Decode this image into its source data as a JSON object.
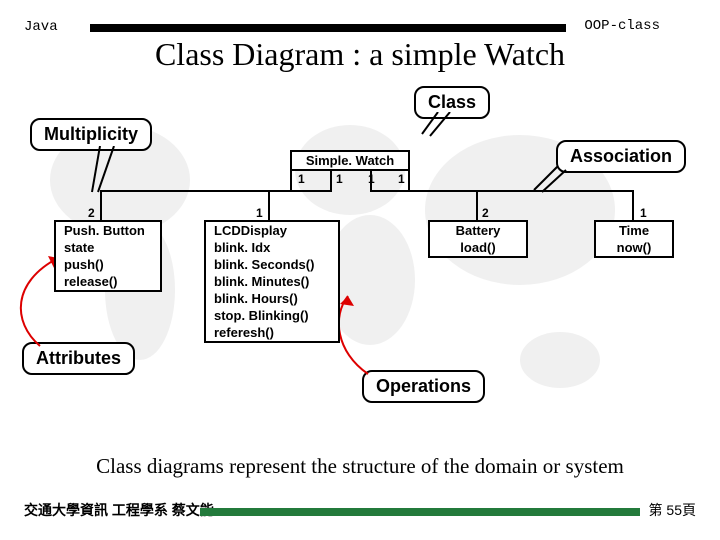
{
  "header": {
    "left": "Java",
    "right": "OOP-class"
  },
  "title": "Class Diagram : a simple Watch",
  "callouts": {
    "class": "Class",
    "multiplicity": "Multiplicity",
    "association": "Association",
    "attributes": "Attributes",
    "operations": "Operations"
  },
  "classes": {
    "simpleWatch": {
      "name": "Simple. Watch"
    },
    "pushButton": {
      "name": "Push. Button",
      "attrs": [
        "state"
      ],
      "ops": [
        "push()",
        "release()"
      ]
    },
    "lcdDisplay": {
      "name": "LCDDisplay",
      "attrs": [
        "blink. Idx"
      ],
      "ops": [
        "blink. Seconds()",
        "blink. Minutes()",
        "blink. Hours()",
        "stop. Blinking()",
        "referesh()"
      ]
    },
    "battery": {
      "name": "Battery",
      "ops": [
        "load()"
      ]
    },
    "time": {
      "name": "Time",
      "ops": [
        "now()"
      ]
    }
  },
  "multiplicities": {
    "sw_pb": "1",
    "sw_lcd": "1",
    "sw_bat": "1",
    "sw_time": "1",
    "pb": "2",
    "lcd": "1",
    "bat": "2",
    "time": "1"
  },
  "description": "Class diagrams represent the structure of the domain or system",
  "footer": {
    "left": "交通大學資訊 工程學系  蔡文能",
    "right": "第 55頁"
  }
}
